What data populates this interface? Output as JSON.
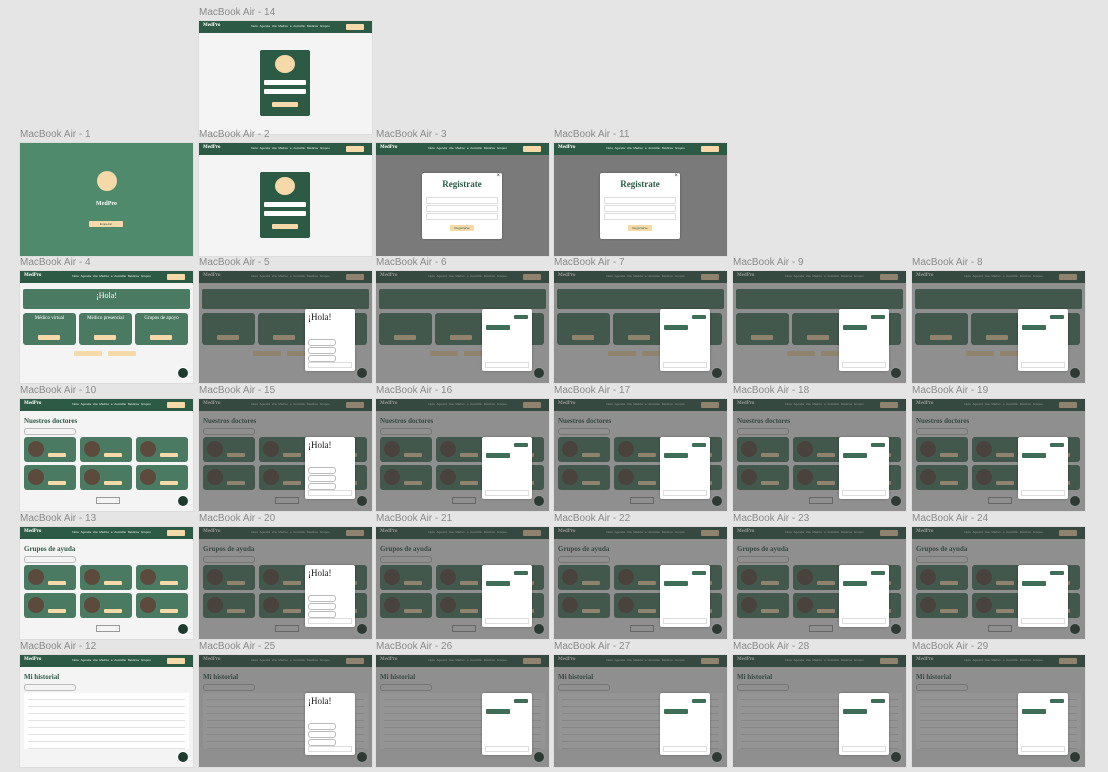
{
  "frames": [
    {
      "id": "mba-14",
      "label": "MacBook Air - 14",
      "type": "login"
    },
    {
      "id": "mba-1",
      "label": "MacBook Air - 1",
      "type": "splash",
      "app_title": "MedPro",
      "button": "Empezar"
    },
    {
      "id": "mba-2",
      "label": "MacBook Air - 2",
      "type": "login"
    },
    {
      "id": "mba-3",
      "label": "MacBook Air - 3",
      "type": "register",
      "title": "Registrate",
      "button": "Registrarse"
    },
    {
      "id": "mba-11",
      "label": "MacBook Air - 11",
      "type": "register",
      "title": "Registrate",
      "button": "Registrarse"
    },
    {
      "id": "mba-4",
      "label": "MacBook Air - 4",
      "type": "home",
      "hero": "¡Hola!",
      "cards": [
        "Médico virtual",
        "Médico presencial",
        "Grupos de apoyo"
      ]
    },
    {
      "id": "mba-5",
      "label": "MacBook Air - 5",
      "type": "home",
      "chat_greeting": "¡Hola!"
    },
    {
      "id": "mba-6",
      "label": "MacBook Air - 6",
      "type": "home"
    },
    {
      "id": "mba-7",
      "label": "MacBook Air - 7",
      "type": "home"
    },
    {
      "id": "mba-9",
      "label": "MacBook Air - 9",
      "type": "home"
    },
    {
      "id": "mba-8",
      "label": "MacBook Air - 8",
      "type": "home"
    },
    {
      "id": "mba-10",
      "label": "MacBook Air - 10",
      "type": "doctors",
      "heading": "Nuestros doctores"
    },
    {
      "id": "mba-15",
      "label": "MacBook Air - 15",
      "type": "doctors",
      "heading": "Nuestros doctores",
      "chat_greeting": "¡Hola!"
    },
    {
      "id": "mba-16",
      "label": "MacBook Air - 16",
      "type": "doctors",
      "heading": "Nuestros doctores"
    },
    {
      "id": "mba-17",
      "label": "MacBook Air - 17",
      "type": "doctors",
      "heading": "Nuestros doctores"
    },
    {
      "id": "mba-18",
      "label": "MacBook Air - 18",
      "type": "doctors",
      "heading": "Nuestros doctores"
    },
    {
      "id": "mba-19",
      "label": "MacBook Air - 19",
      "type": "doctors",
      "heading": "Nuestros doctores"
    },
    {
      "id": "mba-13",
      "label": "MacBook Air - 13",
      "type": "groups",
      "heading": "Grupos de ayuda"
    },
    {
      "id": "mba-20",
      "label": "MacBook Air - 20",
      "type": "groups",
      "heading": "Grupos de ayuda",
      "chat_greeting": "¡Hola!"
    },
    {
      "id": "mba-21",
      "label": "MacBook Air - 21",
      "type": "groups",
      "heading": "Grupos de ayuda"
    },
    {
      "id": "mba-22",
      "label": "MacBook Air - 22",
      "type": "groups",
      "heading": "Grupos de ayuda"
    },
    {
      "id": "mba-23",
      "label": "MacBook Air - 23",
      "type": "groups",
      "heading": "Grupos de ayuda"
    },
    {
      "id": "mba-24",
      "label": "MacBook Air - 24",
      "type": "groups",
      "heading": "Grupos de ayuda"
    },
    {
      "id": "mba-12",
      "label": "MacBook Air - 12",
      "type": "history",
      "heading": "Mi historial"
    },
    {
      "id": "mba-25",
      "label": "MacBook Air - 25",
      "type": "history",
      "heading": "Mi historial",
      "chat_greeting": "¡Hola!"
    },
    {
      "id": "mba-26",
      "label": "MacBook Air - 26",
      "type": "history",
      "heading": "Mi historial"
    },
    {
      "id": "mba-27",
      "label": "MacBook Air - 27",
      "type": "history",
      "heading": "Mi historial"
    },
    {
      "id": "mba-28",
      "label": "MacBook Air - 28",
      "type": "history",
      "heading": "Mi historial"
    },
    {
      "id": "mba-29",
      "label": "MacBook Air - 29",
      "type": "history",
      "heading": "Mi historial"
    }
  ],
  "nav": {
    "brand": "MedPro",
    "links": "Inicio   Agenda cita   Médico a domicilio   Médicos   Grupos"
  },
  "colors": {
    "primary": "#2d5a45",
    "card": "#4b7a63",
    "accent": "#f6d9a8",
    "canvas": "#e5e5e5"
  }
}
